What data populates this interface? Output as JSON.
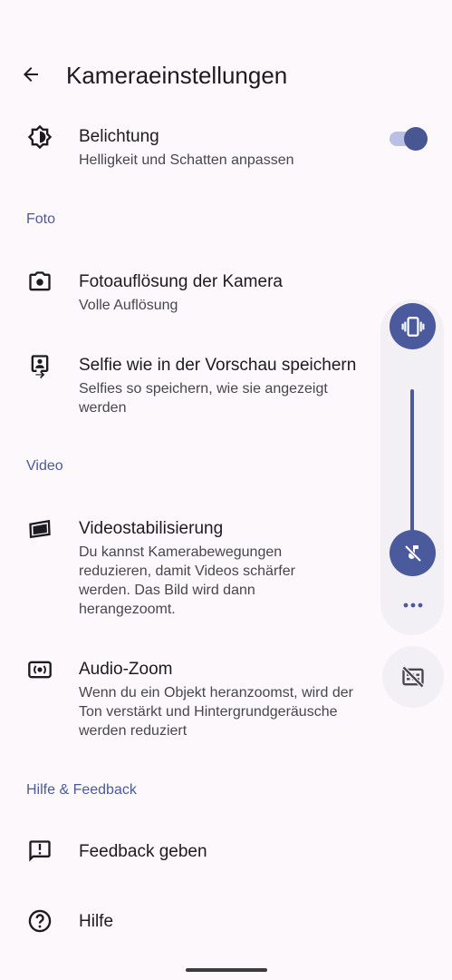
{
  "header": {
    "title": "Kameraeinstellungen",
    "back_icon": "arrow-back-icon"
  },
  "settings": {
    "exposure": {
      "label": "Belichtung",
      "sub": "Helligkeit und Schatten anpassen",
      "toggle_on": true
    },
    "photo_section": "Foto",
    "photo_resolution": {
      "label": "Fotoauflösung der Kamera",
      "sub": "Volle Auflösung"
    },
    "selfie": {
      "label": "Selfie wie in der Vorschau speichern",
      "sub": "Selfies so speichern, wie sie angezeigt werden"
    },
    "video_section": "Video",
    "stabilization": {
      "label": "Videostabilisierung",
      "sub": "Du kannst Kamerabewegungen reduzieren, damit Videos schärfer werden. Das Bild wird dann herangezoomt."
    },
    "audio_zoom": {
      "label": "Audio-Zoom",
      "sub": "Wenn du ein Objekt heranzoomst, wird der Ton verstärkt und Hintergrundgeräusche werden reduziert"
    },
    "help_section": "Hilfe & Feedback",
    "feedback": {
      "label": "Feedback geben"
    },
    "help": {
      "label": "Hilfe"
    }
  },
  "volume_panel": {
    "ringer_icon": "vibrate-icon",
    "mute_icon": "music-off-icon",
    "more_icon": "more-horiz-icon",
    "caption_icon": "captions-off-icon"
  },
  "colors": {
    "accent": "#4b5a9c",
    "section_text": "#4b5a9c",
    "background": "#fcf8fc"
  }
}
